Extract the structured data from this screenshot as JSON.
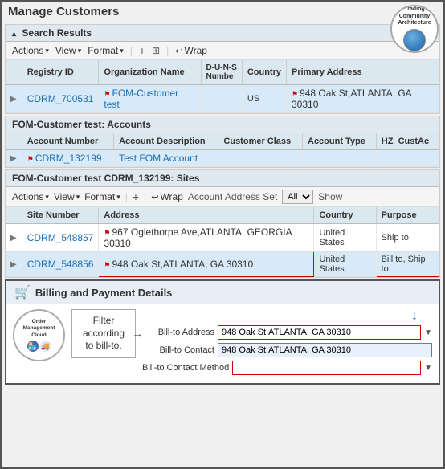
{
  "header": {
    "title": "Manage Customers",
    "tca": {
      "line1": "Trading",
      "line2": "Community",
      "line3": "Architecture"
    }
  },
  "search_results": {
    "section_label": "Search Results",
    "toolbar": {
      "actions": "Actions",
      "view": "View",
      "format": "Format",
      "wrap": "Wrap"
    },
    "columns": [
      "Registry ID",
      "Organization Name",
      "D-U-N-S Number",
      "Country",
      "Primary Address"
    ],
    "rows": [
      {
        "registry_id": "CDRM_700531",
        "org_name": "FOM-Customer test",
        "duns": "",
        "country": "US",
        "address": "948 Oak St,ATLANTA, GA 30310"
      }
    ]
  },
  "accounts": {
    "section_label": "FOM-Customer test: Accounts",
    "columns": [
      "Account Number",
      "Account Description",
      "Customer Class",
      "Account Type",
      "HZ_CustAc"
    ],
    "rows": [
      {
        "account_number": "CDRM_132199",
        "description": "Test FOM Account",
        "customer_class": "",
        "account_type": ""
      }
    ]
  },
  "sites": {
    "section_label": "FOM-Customer test CDRM_132199: Sites",
    "toolbar": {
      "actions": "Actions",
      "view": "View",
      "format": "Format",
      "wrap": "Wrap",
      "account_address_set_label": "Account Address Set",
      "account_address_set_value": "All",
      "show": "Show"
    },
    "columns": [
      "Site Number",
      "Address",
      "Country",
      "Purpose"
    ],
    "rows": [
      {
        "site_number": "CDRM_548857",
        "address": "967 Oglethorpe Ave,ATLANTA, GEORGIA 30310",
        "country": "United States",
        "purpose": "Ship to"
      },
      {
        "site_number": "CDRM_548856",
        "address": "948 Oak St,ATLANTA, GA 30310",
        "country": "United States",
        "purpose": "Bill to, Ship to"
      }
    ]
  },
  "billing": {
    "section_label": "Billing and Payment Details",
    "omc": {
      "line1": "Order",
      "line2": "Management",
      "line3": "Cloud"
    },
    "filter_callout": "Filter according to bill-to.",
    "fields": {
      "bill_to_address_label": "Bill-to Address",
      "bill_to_address_value": "948 Oak St,ATLANTA, GA 30310",
      "bill_to_contact_label": "Bill-to Contact",
      "bill_to_contact_value": "948 Oak St,ATLANTA, GA 30310",
      "bill_to_contact_method_label": "Bill-to Contact Method"
    },
    "blue_arrow": "▼"
  }
}
